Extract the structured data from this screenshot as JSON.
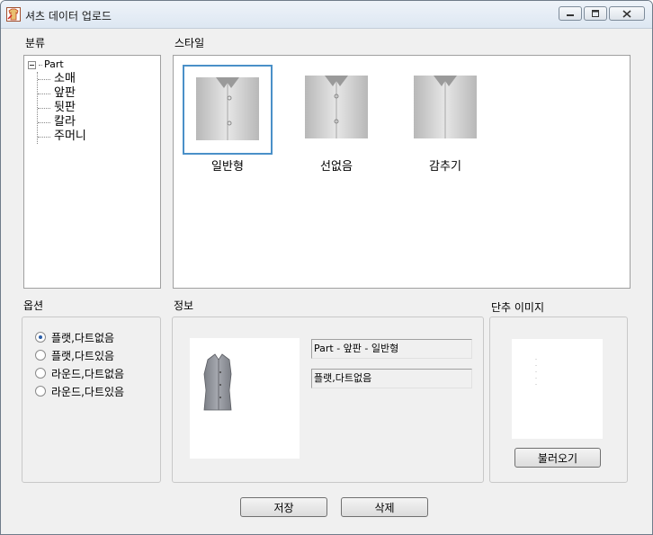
{
  "window": {
    "title": "셔츠 데이터 업로드",
    "icon": "shirt-app-icon",
    "buttons": {
      "minimize": "minimize-icon",
      "maximize": "maximize-icon",
      "close": "close-icon"
    }
  },
  "category": {
    "label": "분류",
    "tree": {
      "root": "Part",
      "children": [
        "소매",
        "앞판",
        "뒷판",
        "칼라",
        "주머니"
      ]
    }
  },
  "style": {
    "label": "스타일",
    "items": [
      {
        "name": "일반형",
        "selected": true
      },
      {
        "name": "선없음",
        "selected": false
      },
      {
        "name": "감추기",
        "selected": false
      }
    ]
  },
  "options": {
    "label": "옵션",
    "items": [
      {
        "label": "플랫,다트없음",
        "checked": true
      },
      {
        "label": "플랫,다트있음",
        "checked": false
      },
      {
        "label": "라운드,다트없음",
        "checked": false
      },
      {
        "label": "라운드,다트있음",
        "checked": false
      }
    ]
  },
  "info": {
    "label": "정보",
    "path_text": "Part - 앞판 - 일반형",
    "option_text": "플랫,다트없음"
  },
  "button_image": {
    "label": "단추 이미지",
    "load_label": "불러오기"
  },
  "actions": {
    "save_label": "저장",
    "delete_label": "삭제"
  }
}
